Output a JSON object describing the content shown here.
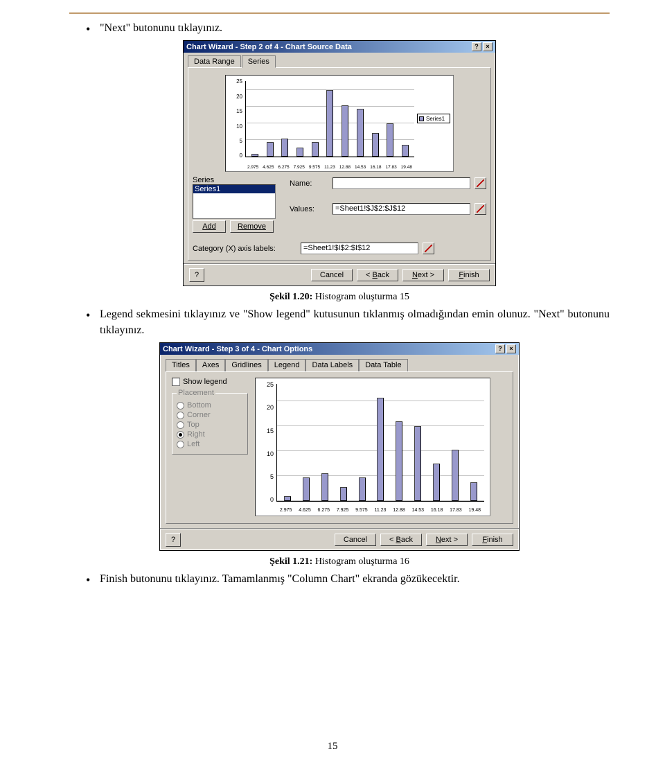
{
  "document": {
    "bullet1": "\"Next\" butonunu tıklayınız.",
    "caption1_a": "Şekil 1.20:",
    "caption1_b": " Histogram oluşturma 15",
    "bullet2_a": "Legend sekmesini tıklayınız ve \"Show legend\" kutusunun tıklanmış olmadığından emin olunuz. \"Next\" butonunu tıklayınız.",
    "caption2_a": "Şekil 1.21:",
    "caption2_b": " Histogram oluşturma 16",
    "bullet3": "Finish butonunu tıklayınız. Tamamlanmış \"Column Chart\" ekranda gözükecektir.",
    "page_number": "15"
  },
  "dialog1": {
    "title": "Chart Wizard - Step 2 of 4 - Chart Source Data",
    "help_glyph": "?",
    "close_glyph": "×",
    "tabs": {
      "data_range": "Data Range",
      "series": "Series"
    },
    "legend_series": "Series1",
    "fields": {
      "series_label": "Series",
      "series_item": "Series1",
      "add": "Add",
      "remove": "Remove",
      "name_label": "Name:",
      "name_value": "",
      "values_label": "Values:",
      "values_value": "=Sheet1!$J$2:$J$12",
      "catx_label": "Category (X) axis labels:",
      "catx_value": "=Sheet1!$I$2:$I$12"
    },
    "buttons": {
      "help": "?",
      "cancel": "Cancel",
      "back": "< Back",
      "next": "Next >",
      "finish": "Finish"
    },
    "next_ul": "N",
    "finish_ul": "F",
    "back_ul": "B"
  },
  "dialog2": {
    "title": "Chart Wizard - Step 3 of 4 - Chart Options",
    "tabs": [
      "Titles",
      "Axes",
      "Gridlines",
      "Legend",
      "Data Labels",
      "Data Table"
    ],
    "show_legend": "Show legend",
    "show_ul": "S",
    "placement": "Placement",
    "radios": {
      "bottom": "Bottom",
      "corner": "Corner",
      "top": "Top",
      "right": "Right",
      "left": "Left"
    },
    "buttons": {
      "help": "?",
      "cancel": "Cancel",
      "back": "< Back",
      "next": "Next >",
      "finish": "Finish"
    },
    "next_ul": "N",
    "finish_ul": "F",
    "back_ul": "B"
  },
  "chart_data": [
    {
      "type": "bar",
      "categories": [
        "2.975",
        "4.625",
        "6.275",
        "7.925",
        "9.575",
        "11.23",
        "12.88",
        "14.53",
        "16.18",
        "17.83",
        "19.48"
      ],
      "values": [
        1,
        5,
        6,
        3,
        5,
        22,
        17,
        16,
        8,
        11,
        4
      ],
      "series_name": "Series1",
      "ylim": [
        0,
        25
      ],
      "yticks": [
        0,
        5,
        10,
        15,
        20,
        25
      ]
    },
    {
      "type": "bar",
      "categories": [
        "2.975",
        "4.625",
        "6.275",
        "7.925",
        "9.575",
        "11.23",
        "12.88",
        "14.53",
        "16.18",
        "17.83",
        "19.48"
      ],
      "values": [
        1,
        5,
        6,
        3,
        5,
        22,
        17,
        16,
        8,
        11,
        4
      ],
      "ylim": [
        0,
        25
      ],
      "yticks": [
        0,
        5,
        10,
        15,
        20,
        25
      ]
    }
  ]
}
